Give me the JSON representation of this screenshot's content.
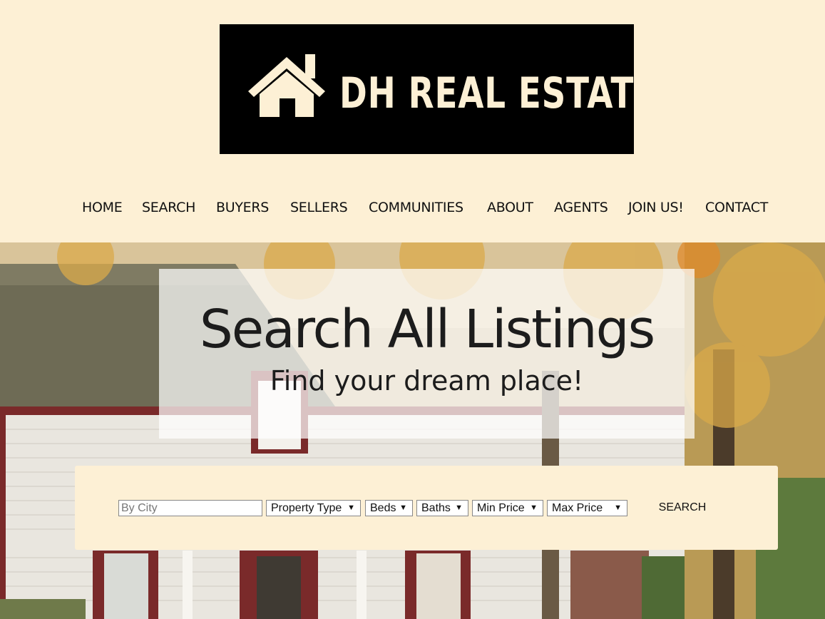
{
  "brand": {
    "name": "DH REAL ESTATE",
    "logo_icon": "house-icon"
  },
  "nav": [
    "HOME",
    "SEARCH",
    "BUYERS",
    "SELLERS",
    "COMMUNITIES",
    "ABOUT",
    "AGENTS",
    "JOIN US!",
    "CONTACT"
  ],
  "hero": {
    "title": "Search All Listings",
    "subtitle": "Find your dream place!"
  },
  "search": {
    "city_placeholder": "By City",
    "property_type": "Property Type",
    "beds": "Beds",
    "baths": "Baths",
    "min_price": "Min Price",
    "max_price": "Max Price",
    "button": "SEARCH",
    "arrow": "▼"
  },
  "colors": {
    "background": "#fdf0d5",
    "logo_bg": "#000000",
    "logo_fg": "#fdf0d5"
  }
}
